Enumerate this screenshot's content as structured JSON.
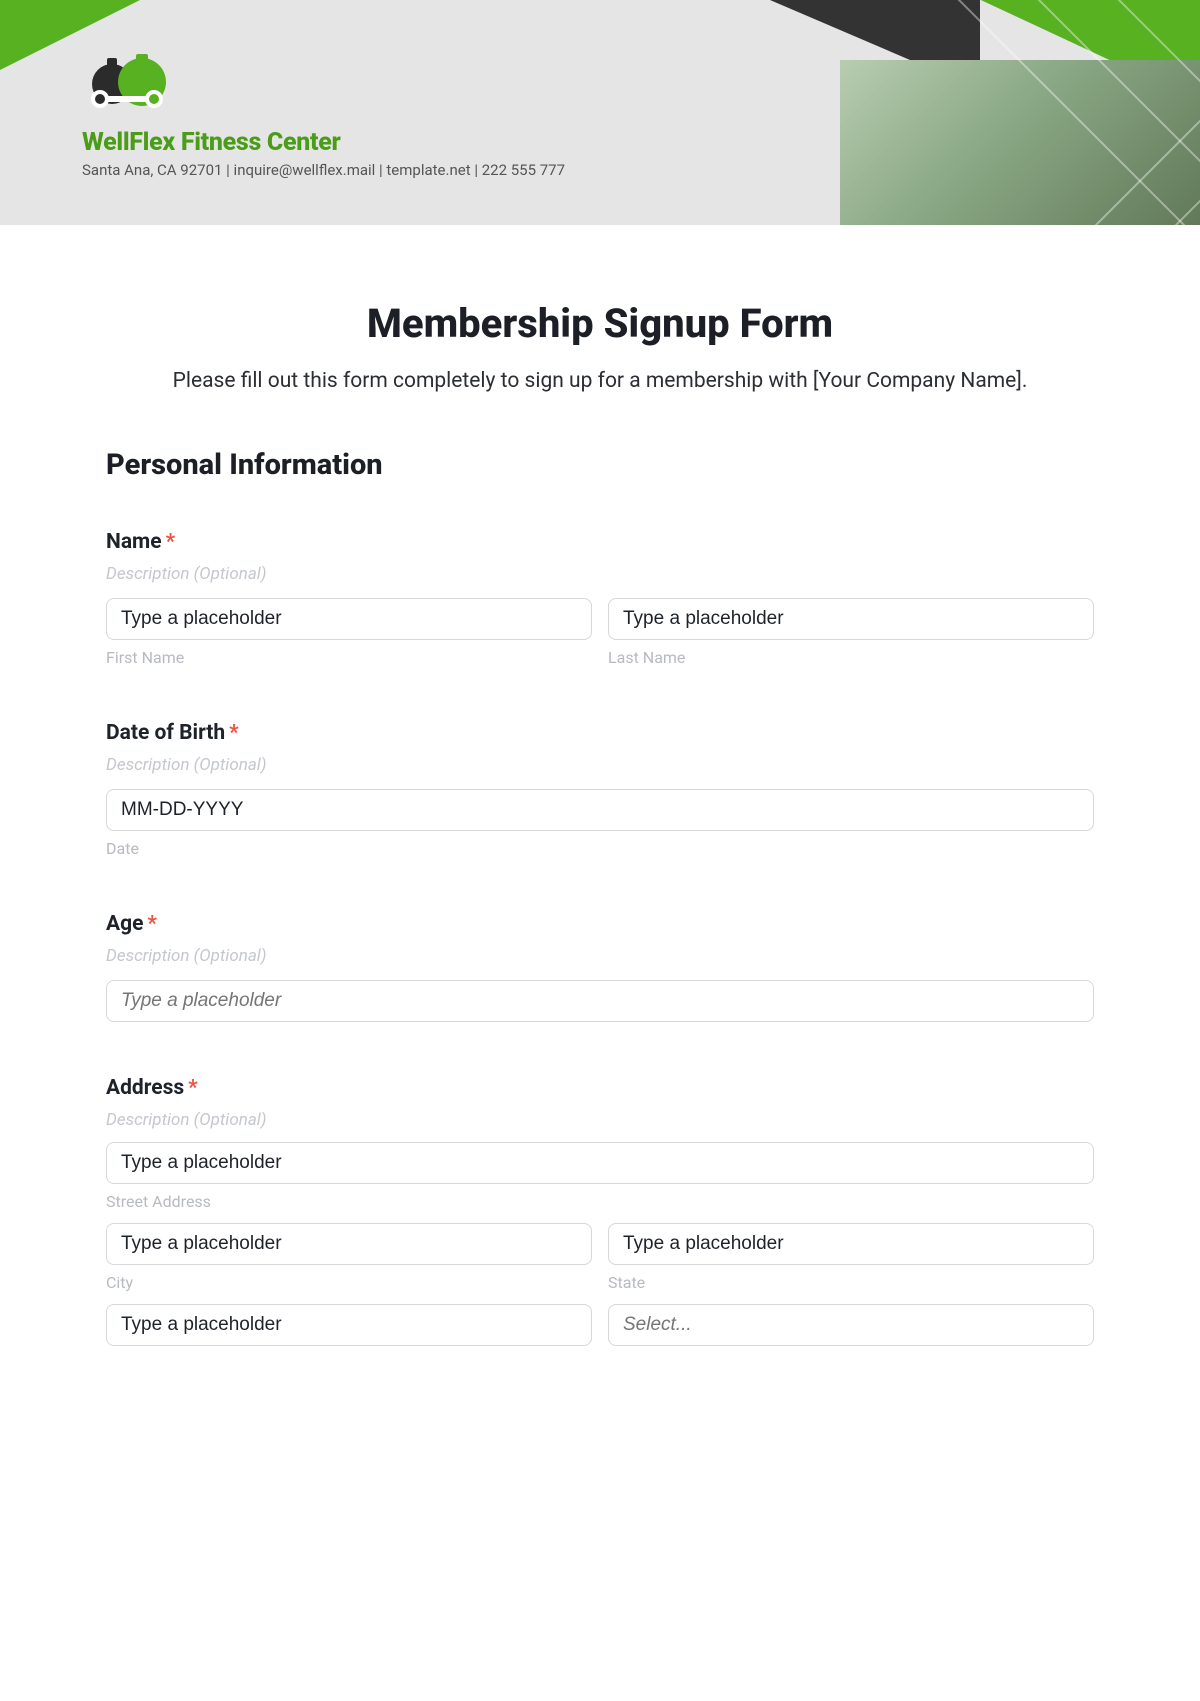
{
  "brand": {
    "name": "WellFlex Fitness Center",
    "info": "Santa Ana, CA 92701 | inquire@wellflex.mail | template.net | 222 555 777"
  },
  "form": {
    "title": "Membership Signup Form",
    "subtitle": "Please fill out this form completely to sign up for a membership with [Your Company Name].",
    "section_personal": "Personal Information",
    "desc_optional": "Description (Optional)",
    "name": {
      "label": "Name",
      "first_placeholder": "Type a placeholder",
      "first_sub": "First Name",
      "last_placeholder": "Type a placeholder",
      "last_sub": "Last Name"
    },
    "dob": {
      "label": "Date of Birth",
      "placeholder": "MM-DD-YYYY",
      "sub": "Date"
    },
    "age": {
      "label": "Age",
      "placeholder": "Type a placeholder"
    },
    "address": {
      "label": "Address",
      "street_placeholder": "Type a placeholder",
      "street_sub": "Street Address",
      "city_placeholder": "Type a placeholder",
      "city_sub": "City",
      "state_placeholder": "Type a placeholder",
      "state_sub": "State",
      "zip_placeholder": "Type a placeholder",
      "country_placeholder": "Select..."
    },
    "required_mark": "*"
  }
}
